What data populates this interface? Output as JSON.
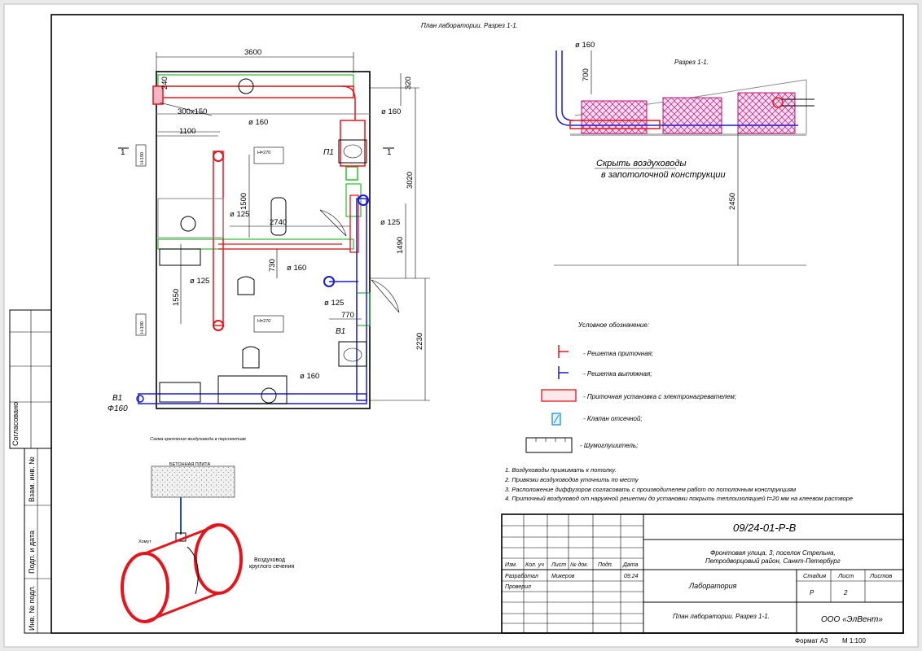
{
  "plan": {
    "title": "План лаборатории. Разрез 1-1.",
    "dims": {
      "d3600": "3600",
      "d320": "320",
      "d240": "240",
      "d1100": "1100",
      "d3020": "3020",
      "d1500": "1500",
      "d2740": "2740",
      "d1490": "1490",
      "d730": "730",
      "d1550": "1550",
      "d770": "770",
      "d2230": "2230"
    },
    "labels": {
      "duct300x150": "300x150",
      "o160_a": "ø 160",
      "o160_b": "ø 160",
      "o160_c": "ø 160",
      "o160_d": "ø 160",
      "o125_a": "ø 125",
      "o125_b": "ø 125",
      "o125_c": "ø 125",
      "o125_d": "ø 125",
      "p1": "П1",
      "b1_right": "В1",
      "b1_left": "В1",
      "phi160": "Ф160",
      "sec1_left": "1",
      "sec1_right": "1"
    },
    "unit_labels": {
      "unit1": "Н=270",
      "unit2": "Н=270",
      "tag": "Н-190"
    }
  },
  "section": {
    "title": "Разрез 1-1.",
    "o160": "ø 160",
    "d700": "700",
    "d2450": "2450",
    "note_line1": "Скрыть воздуховоды",
    "note_line2": "в запотолочной конструкции"
  },
  "mount": {
    "title": "Схема крепления воздуховода в перспективе",
    "slab": "БЕТОННАЯ ПЛИТА",
    "clamp": "Хомут",
    "duct_line1": "Воздуховод",
    "duct_line2": "круглого сечения"
  },
  "legend": {
    "title": "Условное обозначение:",
    "items": [
      {
        "label": "- Решетка приточная;",
        "color": "#e8141c"
      },
      {
        "label": "- Решетка вытяжная;",
        "color": "#1a1ad0"
      },
      {
        "label": "- Приточная установка с электронагревателем;",
        "color": "#e8141c"
      },
      {
        "label": "- Клапан отсечной;",
        "color": "#1a8fd0"
      },
      {
        "label": "- Шумоглушитель;",
        "color": "#000000"
      }
    ]
  },
  "notes": [
    "1.  Воздуховоды прижимать к потолку.",
    "2.  Привязки воздуховодов уточнить по месту",
    "3.  Расположение диффузоров согласовать с производителем работ по потолочным конструкциям",
    "4.  Приточный воздуховод от наружной решетки до установки покрыть теплоизоляцией t=20 мм на клеевом растворе"
  ],
  "side_stamp": {
    "agreed": "Согласовано",
    "inv_replace": "Взам. инв. №",
    "sign_date": "Подп. и дата",
    "inv_orig": "Инв. № подл."
  },
  "title_block": {
    "code": "09/24-01-Р-В",
    "address_line1": "Фронтовая улица, 3, поселок Стрельна,",
    "address_line2": "Петродворцовый район, Санкт-Петербург",
    "headers": {
      "izm": "Изм.",
      "kol": "Кол. уч",
      "list": "Лист",
      "ndok": "№ док.",
      "podp": "Подп.",
      "data": "Дата"
    },
    "developed_label": "Разработал",
    "developed_name": "Микеров",
    "developed_date": "09.24",
    "checked_label": "Проверил",
    "object": "Лаборатория",
    "stage_h": "Стадия",
    "sheet_h": "Лист",
    "sheets_h": "Листов",
    "stage": "Р",
    "sheet": "2",
    "sheets": "",
    "drawing_name": "План лаборатории. Разрез 1-1.",
    "company": "ООО «ЭлВент»",
    "format": "Формат А3",
    "scale": "М 1:100"
  }
}
